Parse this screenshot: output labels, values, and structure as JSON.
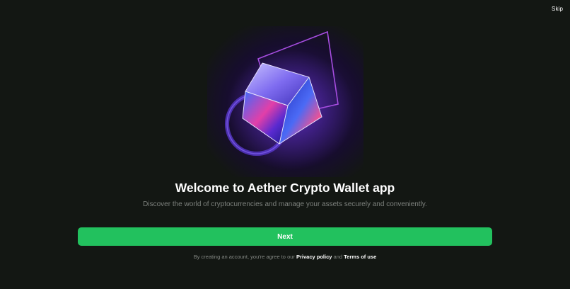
{
  "header": {
    "skip_label": "Skip"
  },
  "hero": {
    "image": "crypto-cube-illustration"
  },
  "main": {
    "title": "Welcome to Aether Crypto Wallet app",
    "subtitle": "Discover the world of cryptocurrencies and manage your assets securely and conveniently.",
    "next_label": "Next"
  },
  "footer": {
    "terms_prefix": "By creating an account, you're agree to our",
    "privacy_label": "Privacy policy",
    "and_text": "and",
    "terms_label": "Terms of use"
  },
  "colors": {
    "background": "#131713",
    "accent": "#22c15e",
    "text_primary": "#ffffff",
    "text_secondary": "#7d817d"
  }
}
